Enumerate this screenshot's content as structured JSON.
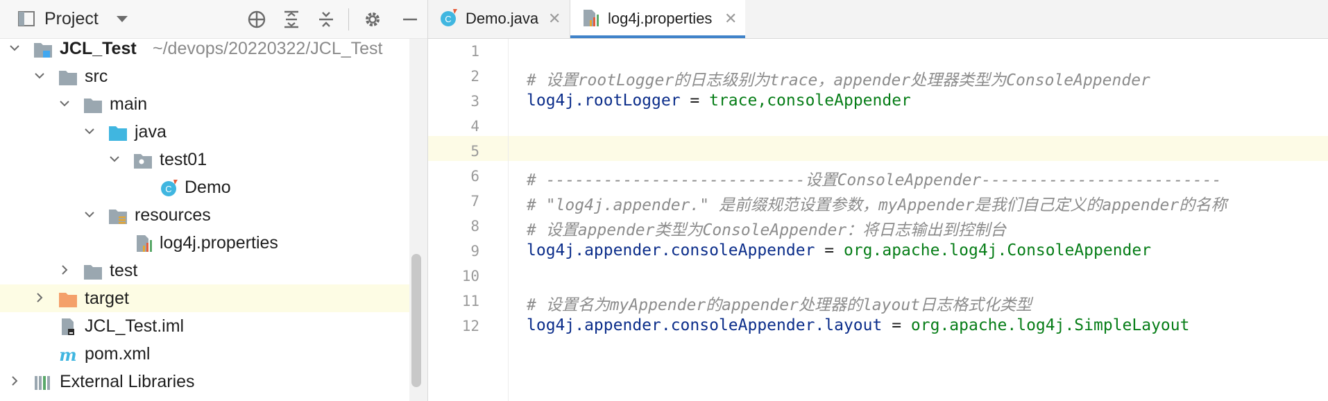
{
  "project_panel": {
    "title": "Project",
    "toolbar_icons": [
      "locate-icon",
      "expand-all-icon",
      "collapse-all-icon",
      "gear-icon",
      "minimize-icon"
    ],
    "tree": [
      {
        "label": "JCL_Test",
        "path": "~/devops/20220322/JCL_Test",
        "icon": "module-folder-icon",
        "expanded": true,
        "depth": 0
      },
      {
        "label": "src",
        "icon": "folder-icon",
        "expanded": true,
        "depth": 1
      },
      {
        "label": "main",
        "icon": "folder-icon",
        "expanded": true,
        "depth": 2
      },
      {
        "label": "java",
        "icon": "source-folder-icon",
        "expanded": true,
        "depth": 3
      },
      {
        "label": "test01",
        "icon": "package-icon",
        "expanded": true,
        "depth": 4
      },
      {
        "label": "Demo",
        "icon": "java-class-icon",
        "depth": 5
      },
      {
        "label": "resources",
        "icon": "resources-folder-icon",
        "expanded": true,
        "depth": 3
      },
      {
        "label": "log4j.properties",
        "icon": "properties-file-icon",
        "depth": 4
      },
      {
        "label": "test",
        "icon": "folder-icon",
        "expanded": false,
        "depth": 2
      },
      {
        "label": "target",
        "icon": "excluded-folder-icon",
        "expanded": false,
        "depth": 1,
        "selected": true
      },
      {
        "label": "JCL_Test.iml",
        "icon": "iml-file-icon",
        "depth": 1
      },
      {
        "label": "pom.xml",
        "icon": "maven-icon",
        "depth": 1
      },
      {
        "label": "External Libraries",
        "icon": "library-icon",
        "expanded": false,
        "depth": 0
      }
    ]
  },
  "editor": {
    "tabs": [
      {
        "label": "Demo.java",
        "icon": "java-class-icon",
        "active": false
      },
      {
        "label": "log4j.properties",
        "icon": "properties-file-icon",
        "active": true
      }
    ],
    "caret_line": 5,
    "lines": [
      {
        "n": "1",
        "parts": []
      },
      {
        "n": "2",
        "parts": [
          {
            "t": "comment",
            "s": "# 设置rootLogger的日志级别为trace，appender处理器类型为ConsoleAppender"
          }
        ]
      },
      {
        "n": "3",
        "parts": [
          {
            "t": "key",
            "s": "log4j.rootLogger"
          },
          {
            "t": "eq",
            "s": " = "
          },
          {
            "t": "val",
            "s": "trace,consoleAppender"
          }
        ]
      },
      {
        "n": "4",
        "parts": []
      },
      {
        "n": "5",
        "parts": []
      },
      {
        "n": "6",
        "parts": [
          {
            "t": "comment",
            "s": "# ---------------------------设置ConsoleAppender-------------------------"
          }
        ]
      },
      {
        "n": "7",
        "parts": [
          {
            "t": "comment",
            "s": "# \"log4j.appender.\" 是前缀规范设置参数，myAppender是我们自己定义的appender的名称"
          }
        ]
      },
      {
        "n": "8",
        "parts": [
          {
            "t": "comment",
            "s": "# 设置appender类型为ConsoleAppender：将日志输出到控制台"
          }
        ]
      },
      {
        "n": "9",
        "parts": [
          {
            "t": "key",
            "s": "log4j.appender.consoleAppender"
          },
          {
            "t": "eq",
            "s": " = "
          },
          {
            "t": "val",
            "s": "org.apache.log4j.ConsoleAppender"
          }
        ]
      },
      {
        "n": "10",
        "parts": []
      },
      {
        "n": "11",
        "parts": [
          {
            "t": "comment",
            "s": "# 设置名为myAppender的appender处理器的layout日志格式化类型"
          }
        ]
      },
      {
        "n": "12",
        "parts": [
          {
            "t": "key",
            "s": "log4j.appender.consoleAppender.layout"
          },
          {
            "t": "eq",
            "s": " = "
          },
          {
            "t": "val",
            "s": "org.apache.log4j.SimpleLayout"
          }
        ]
      }
    ]
  },
  "colors": {
    "selection": "#fdfce4",
    "accent": "#4083c9",
    "comment": "#8c8c8c",
    "key": "#0b2d8a",
    "value": "#067d17"
  }
}
